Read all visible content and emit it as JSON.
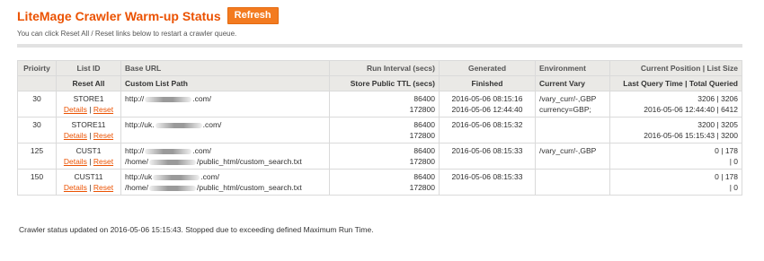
{
  "title": "LiteMage Crawler Warm-up Status",
  "refresh_label": "Refresh",
  "help_text": "You can click Reset All / Reset links below to restart a crawler queue.",
  "headers": {
    "priority": "Prioirty",
    "list_id": "List ID",
    "reset_all": "Reset All",
    "base_url": "Base URL",
    "custom_list_path": "Custom List Path",
    "run_interval": "Run Interval (secs)",
    "store_ttl": "Store Public TTL (secs)",
    "generated": "Generated",
    "finished": "Finished",
    "environment": "Environment",
    "current_vary": "Current Vary",
    "current_position": "Current Position | List Size",
    "last_query": "Last Query Time | Total Queried"
  },
  "rows": [
    {
      "priority": "30",
      "list_id": "STORE1",
      "details": "Details",
      "sep": "|",
      "reset": "Reset",
      "url_prefix": "http://",
      "url_suffix": ".com/",
      "path_prefix": "",
      "path_suffix": "",
      "interval": "86400",
      "ttl": "172800",
      "generated": "2016-05-06 08:15:16",
      "finished": "2016-05-06 12:44:40",
      "env": "/vary_curr/-,GBP",
      "vary": "currency=GBP;",
      "position": "3206 | 3206",
      "last": "2016-05-06 12:44:40 | 6412"
    },
    {
      "priority": "30",
      "list_id": "STORE11",
      "details": "Details",
      "sep": "|",
      "reset": "Reset",
      "url_prefix": "http://uk.",
      "url_suffix": ".com/",
      "path_prefix": "",
      "path_suffix": "",
      "interval": "86400",
      "ttl": "172800",
      "generated": "2016-05-06 08:15:32",
      "finished": "",
      "env": "",
      "vary": "",
      "position": "3200 | 3205",
      "last": "2016-05-06 15:15:43 | 3200"
    },
    {
      "priority": "125",
      "list_id": "CUST1",
      "details": "Details",
      "sep": "|",
      "reset": "Reset",
      "url_prefix": "http://",
      "url_suffix": ".com/",
      "path_prefix": "/home/",
      "path_suffix": "/public_html/custom_search.txt",
      "interval": "86400",
      "ttl": "172800",
      "generated": "2016-05-06 08:15:33",
      "finished": "",
      "env": "/vary_curr/-,GBP",
      "vary": "",
      "position": "0 | 178",
      "last": "| 0"
    },
    {
      "priority": "150",
      "list_id": "CUST11",
      "details": "Details",
      "sep": "|",
      "reset": "Reset",
      "url_prefix": "http://uk",
      "url_suffix": ".com/",
      "path_prefix": "/home/",
      "path_suffix": "/public_html/custom_search.txt",
      "interval": "86400",
      "ttl": "172800",
      "generated": "2016-05-06 08:15:33",
      "finished": "",
      "env": "",
      "vary": "",
      "position": "0 | 178",
      "last": "| 0"
    }
  ],
  "status_text": "Crawler status updated on 2016-05-06 15:15:43. Stopped due to exceeding defined Maximum Run Time.",
  "colors": {
    "accent": "#eb5202",
    "button": "#f37b20",
    "header_bg": "#eae9e6"
  }
}
